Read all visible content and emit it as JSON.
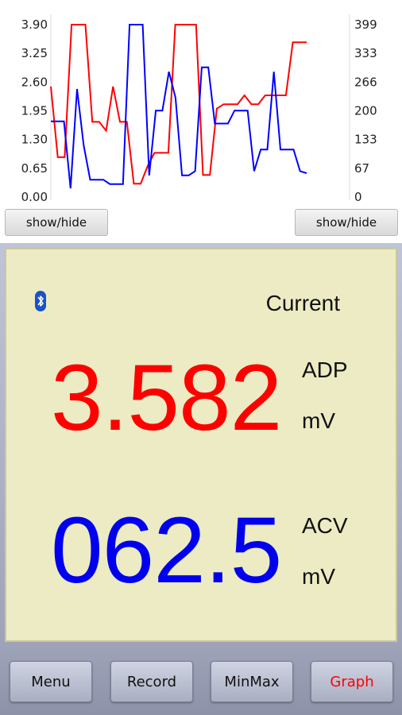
{
  "chart": {
    "left_axis_ticks": [
      "3.90",
      "3.25",
      "2.60",
      "1.95",
      "1.30",
      "0.65",
      "0.00"
    ],
    "right_axis_ticks": [
      "399",
      "333",
      "266",
      "200",
      "133",
      "67",
      "0"
    ],
    "toggle_left_label": "show/hide",
    "toggle_right_label": "show/hide"
  },
  "chart_data": {
    "type": "line",
    "ylim_left": [
      0,
      3.9
    ],
    "ylim_right": [
      0,
      399
    ],
    "grid": false,
    "series": [
      {
        "axis": "left",
        "color": "#ff0000",
        "values": [
          2.5,
          0.9,
          0.9,
          3.9,
          3.9,
          3.9,
          1.7,
          1.7,
          1.5,
          2.5,
          1.7,
          1.7,
          0.3,
          0.3,
          0.7,
          1.0,
          1.0,
          1.0,
          3.9,
          3.9,
          3.9,
          3.9,
          0.5,
          0.5,
          2.0,
          2.1,
          2.1,
          2.1,
          2.3,
          2.1,
          2.1,
          2.3,
          2.3,
          2.3,
          2.3,
          3.5,
          3.5,
          3.5
        ]
      },
      {
        "axis": "right",
        "color": "#0000ff",
        "values": [
          175,
          175,
          175,
          20,
          250,
          120,
          40,
          40,
          40,
          30,
          30,
          30,
          399,
          399,
          399,
          50,
          200,
          200,
          290,
          230,
          50,
          50,
          60,
          300,
          300,
          170,
          170,
          170,
          200,
          200,
          200,
          60,
          110,
          110,
          290,
          110,
          110,
          110,
          60,
          55
        ]
      }
    ]
  },
  "meter": {
    "mode": "Current",
    "primary": {
      "value": "3.582",
      "function": "ADP",
      "unit": "mV",
      "color": "#ff0000"
    },
    "secondary": {
      "value": "062.5",
      "function": "ACV",
      "unit": "mV",
      "color": "#0000ee"
    },
    "bluetooth_icon": "bluetooth-icon"
  },
  "toolbar": {
    "menu": "Menu",
    "record": "Record",
    "minmax": "MinMax",
    "graph": "Graph"
  }
}
